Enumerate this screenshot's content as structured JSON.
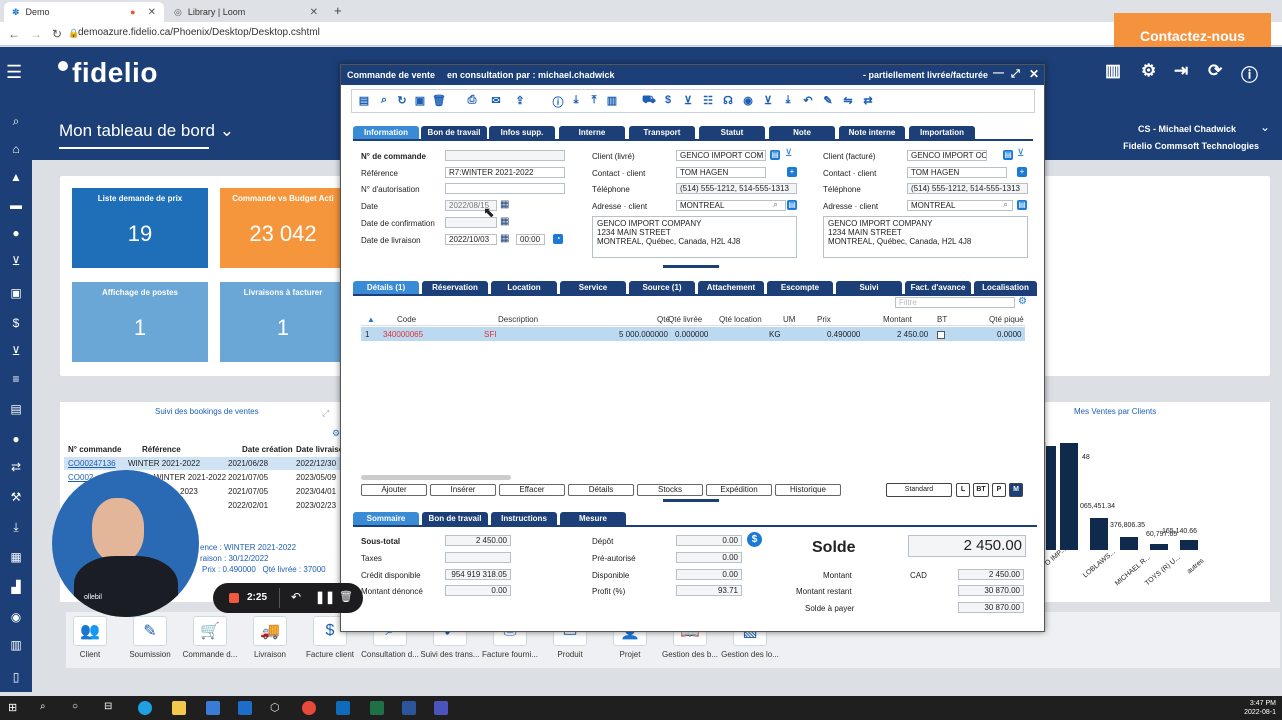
{
  "browser": {
    "tab1": "Demo",
    "tab2": "Library | Loom",
    "new_tab": "+",
    "url": "demoazure.fidelio.ca/Phoenix/Desktop/Desktop.cshtml",
    "contact_button": "Contactez-nous"
  },
  "app": {
    "logo": "fidelio",
    "dashboard_title": "Mon tableau de bord",
    "user_name": "CS - Michael Chadwick",
    "company": "Fidelio Commsoft Technologies"
  },
  "cards": [
    {
      "title": "Liste demande de prix",
      "value": "19",
      "color": "#1f6fb8"
    },
    {
      "title": "Commande vs Budget Acti",
      "value": "23 042",
      "color": "#f6963c"
    },
    {
      "title": "Affichage de postes",
      "value": "1",
      "color": "#6aa6d6"
    },
    {
      "title": "Livraisons à facturer",
      "value": "1",
      "color": "#6aa6d6"
    }
  ],
  "bookings": {
    "title": "Suivi des bookings de ventes",
    "headers": [
      "N° commande",
      "Référence",
      "Date création",
      "Date livraison"
    ],
    "rows": [
      [
        "CO00247136",
        "WINTER 2021-2022",
        "2021/06/28",
        "2022/12/30"
      ],
      [
        "CO002",
        "WINTER 2021-2022",
        "2021/07/05",
        "2023/05/09"
      ],
      [
        "",
        "2023",
        "2021/07/05",
        "2023/04/01"
      ],
      [
        "",
        "",
        "2022/02/01",
        "2023/02/23"
      ]
    ],
    "footer1": "ence : WINTER 2021-2022",
    "footer2": "raison : 30/12/2022",
    "footer3_a": "Prix : 0.490000",
    "footer3_b": "Qté livrée : 37000"
  },
  "sales_chart": {
    "title": "Mes Ventes par Clients",
    "labels": [
      "48",
      "065,451.34",
      "376,806.35",
      "60,797.65",
      "165,140.66"
    ],
    "categories": [
      "O IMP...",
      "LOBLAWS...",
      "MICHAEL R...",
      "TOYS (R) U...",
      "autres"
    ]
  },
  "recorder": {
    "time": "2:25",
    "logo": "ollebil"
  },
  "dock": [
    {
      "label": "Client",
      "icon": "people-icon"
    },
    {
      "label": "Soumission",
      "icon": "document-edit-icon"
    },
    {
      "label": "Commande d...",
      "icon": "cart-icon"
    },
    {
      "label": "Livraison",
      "icon": "truck-icon"
    },
    {
      "label": "Facture client",
      "icon": "invoice-icon"
    },
    {
      "label": "Consultation d...",
      "icon": "search-icon"
    },
    {
      "label": "Suivi des trans...",
      "icon": "check-icon"
    },
    {
      "label": "Facture fourni...",
      "icon": "printer-icon"
    },
    {
      "label": "Produit",
      "icon": "box-icon"
    },
    {
      "label": "Projet",
      "icon": "user-icon"
    },
    {
      "label": "Gestion des b...",
      "icon": "book-icon"
    },
    {
      "label": "Gestion des lo...",
      "icon": "map-icon"
    }
  ],
  "modal": {
    "title": "Commande de vente",
    "subtitle": "en consultation par : michael.chadwick",
    "status": "- partiellement livrée/facturée",
    "tabs": [
      "Information",
      "Bon de travail",
      "Infos supp.",
      "Interne",
      "Transport",
      "Statut",
      "Note",
      "Note interne",
      "Importation"
    ],
    "form": {
      "order_no_label": "N° de commande",
      "order_no": "",
      "reference_label": "Référence",
      "reference": "R7:WINTER 2021-2022",
      "auth_label": "N° d'autorisation",
      "auth": "",
      "date_label": "Date",
      "date": "2022/08/15",
      "confirm_label": "Date de confirmation",
      "confirm": "",
      "delivery_label": "Date de livraison",
      "delivery": "2022/10/03",
      "delivery_time": "00:00",
      "client_label": "Client (livré)",
      "client": "GENCO IMPORT COM",
      "contact_label": "Contact · client",
      "contact": "TOM HAGEN",
      "phone_label": "Téléphone",
      "phone": "(514) 555-1212, 514-555-1313",
      "address_label": "Adresse · client",
      "address": "MONTREAL",
      "address_lines": [
        "GENCO IMPORT COMPANY",
        "1234 MAIN STREET",
        "MONTREAL, Québec, Canada, H2L 4J8"
      ],
      "bill_client_label": "Client (facturé)",
      "bill_client": "GENCO IMPORT CO",
      "bill_contact_label": "Contact · client",
      "bill_contact": "TOM HAGEN",
      "bill_phone_label": "Téléphone",
      "bill_phone": "(514) 555-1212, 514-555-1313",
      "bill_address_label": "Adresse · client",
      "bill_address": "MONTREAL",
      "bill_address_lines": [
        "GENCO IMPORT COMPANY",
        "1234 MAIN STREET",
        "MONTREAL, Québec, Canada, H2L 4J8"
      ]
    },
    "detail_tabs": [
      "Détails (1)",
      "Réservation",
      "Location",
      "Service",
      "Source (1)",
      "Attachement",
      "Escompte",
      "Suivi",
      "Fact. d'avance",
      "Localisation"
    ],
    "filter_placeholder": "Filtre",
    "grid_headers": [
      "Code",
      "Description",
      "Qté",
      "Qté livrée",
      "Qté location",
      "UM",
      "Prix",
      "Montant",
      "BT",
      "Qté piqué"
    ],
    "grid_row": [
      "1",
      "340000065",
      "SFI",
      "5 000.000000",
      "0.000000",
      "",
      "KG",
      "0.490000",
      "2 450.00",
      "",
      "0.0000"
    ],
    "actions": [
      "Ajouter",
      "Insérer",
      "Effacer",
      "Détails",
      "Stocks",
      "Expédition",
      "Historique"
    ],
    "views": [
      "Standard",
      "L",
      "BT",
      "P",
      "M"
    ],
    "summary_tabs": [
      "Sommaire",
      "Bon de travail",
      "Instructions",
      "Mesure"
    ],
    "summary": {
      "subtotal_label": "Sous-total",
      "subtotal": "2 450.00",
      "taxes_label": "Taxes",
      "taxes": "",
      "credit_label": "Crédit disponible",
      "credit": "954 919 318.05",
      "denounced_label": "Montant dénoncé",
      "denounced": "0.00",
      "deposit_label": "Dépôt",
      "deposit": "0.00",
      "preauth_label": "Pré-autorisé",
      "preauth": "0.00",
      "available_label": "Disponible",
      "available": "0.00",
      "profit_label": "Profit (%)",
      "profit": "93.71",
      "balance_label": "Solde",
      "balance": "2 450.00",
      "amount_label": "Montant",
      "currency": "CAD",
      "amount": "2 450.00",
      "remaining_label": "Montant restant",
      "remaining": "30 870.00",
      "topay_label": "Solde à payer",
      "topay": "30 870.00"
    }
  },
  "taskbar": {
    "time": "3:47 PM",
    "date": "2022-08-1"
  }
}
